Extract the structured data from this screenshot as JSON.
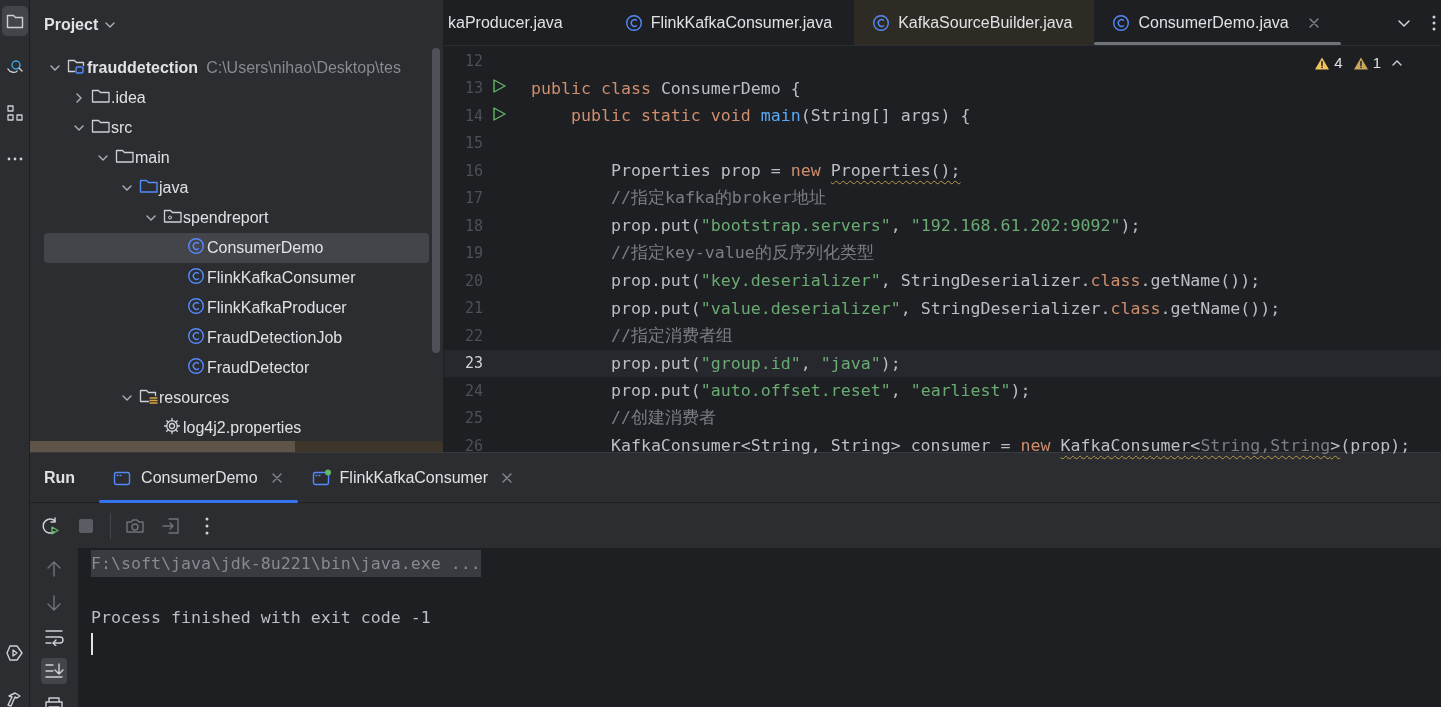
{
  "activity_bar": {
    "items": [
      {
        "kind": "project",
        "selected": true
      },
      {
        "kind": "find",
        "selected": false
      },
      {
        "kind": "structure",
        "selected": false
      },
      {
        "kind": "more",
        "selected": false
      }
    ],
    "bottom_items": [
      {
        "kind": "services"
      },
      {
        "kind": "build"
      }
    ]
  },
  "project_panel": {
    "title": "Project",
    "tree": [
      {
        "label": "frauddetection",
        "path": "C:\\Users\\nihao\\Desktop\\tes",
        "kind": "module",
        "expanded": true,
        "selected": false,
        "children": [
          {
            "label": ".idea",
            "kind": "folder",
            "expanded": false,
            "selected": false
          },
          {
            "label": "src",
            "kind": "folder",
            "expanded": true,
            "selected": false,
            "children": [
              {
                "label": "main",
                "kind": "folder",
                "expanded": true,
                "selected": false,
                "children": [
                  {
                    "label": "java",
                    "kind": "source",
                    "expanded": true,
                    "selected": false,
                    "children": [
                      {
                        "label": "spendreport",
                        "kind": "package",
                        "expanded": true,
                        "selected": false,
                        "children": [
                          {
                            "label": "ConsumerDemo",
                            "kind": "class",
                            "selected": true
                          },
                          {
                            "label": "FlinkKafkaConsumer",
                            "kind": "class",
                            "selected": false
                          },
                          {
                            "label": "FlinkKafkaProducer",
                            "kind": "class",
                            "selected": false
                          },
                          {
                            "label": "FraudDetectionJob",
                            "kind": "class",
                            "selected": false
                          },
                          {
                            "label": "FraudDetector",
                            "kind": "class",
                            "selected": false
                          }
                        ]
                      }
                    ]
                  },
                  {
                    "label": "resources",
                    "kind": "resources",
                    "expanded": true,
                    "selected": false,
                    "children": [
                      {
                        "label": "log4j2.properties",
                        "kind": "settings",
                        "selected": false
                      }
                    ]
                  }
                ]
              }
            ]
          }
        ]
      }
    ]
  },
  "editor": {
    "tabs": [
      {
        "label": "kaProducer.java",
        "kind": "clipped",
        "selected": false
      },
      {
        "label": "FlinkKafkaConsumer.java",
        "kind": "class",
        "selected": false
      },
      {
        "label": "KafkaSourceBuilder.java",
        "kind": "class",
        "selected": false
      },
      {
        "label": "ConsumerDemo.java",
        "kind": "class",
        "selected": true
      }
    ],
    "inspections": [
      {
        "kind": "warning",
        "count": "4"
      },
      {
        "kind": "weak_warning",
        "count": "1"
      }
    ],
    "lines": [
      {
        "number": "12",
        "runnable": false,
        "current": false
      },
      {
        "number": "13",
        "runnable": true,
        "current": false,
        "tokens": [
          {
            "kind": "keyword",
            "text": "public class "
          },
          {
            "kind": "plain",
            "text": "ConsumerDemo {"
          }
        ]
      },
      {
        "number": "14",
        "runnable": true,
        "current": false,
        "tokens": [
          {
            "kind": "keyword",
            "text": "    public static void "
          },
          {
            "kind": "method",
            "text": "main"
          },
          {
            "kind": "plain",
            "text": "(String[] args) {"
          }
        ]
      },
      {
        "number": "15",
        "runnable": false,
        "current": false
      },
      {
        "number": "16",
        "runnable": false,
        "current": false,
        "tokens": [
          {
            "kind": "plain",
            "text": "        Properties prop = "
          },
          {
            "kind": "keyword",
            "text": "new "
          },
          {
            "kind": "flagged",
            "text": "Properties();"
          }
        ]
      },
      {
        "number": "17",
        "runnable": false,
        "current": false,
        "tokens": [
          {
            "kind": "comment",
            "text": "        //指定kafka的broker地址"
          }
        ]
      },
      {
        "number": "18",
        "runnable": false,
        "current": false,
        "tokens": [
          {
            "kind": "plain",
            "text": "        prop.put("
          },
          {
            "kind": "string",
            "text": "\"bootstrap.servers\""
          },
          {
            "kind": "plain",
            "text": ", "
          },
          {
            "kind": "string",
            "text": "\"192.168.61.202:9092\""
          },
          {
            "kind": "plain",
            "text": ");"
          }
        ]
      },
      {
        "number": "19",
        "runnable": false,
        "current": false,
        "tokens": [
          {
            "kind": "comment",
            "text": "        //指定key-value的反序列化类型"
          }
        ]
      },
      {
        "number": "20",
        "runnable": false,
        "current": false,
        "tokens": [
          {
            "kind": "plain",
            "text": "        prop.put("
          },
          {
            "kind": "string",
            "text": "\"key.deserializer\""
          },
          {
            "kind": "plain",
            "text": ", StringDeserializer."
          },
          {
            "kind": "keyword",
            "text": "class"
          },
          {
            "kind": "plain",
            "text": ".getName());"
          }
        ]
      },
      {
        "number": "21",
        "runnable": false,
        "current": false,
        "tokens": [
          {
            "kind": "plain",
            "text": "        prop.put("
          },
          {
            "kind": "string",
            "text": "\"value.deserializer\""
          },
          {
            "kind": "plain",
            "text": ", StringDeserializer."
          },
          {
            "kind": "keyword",
            "text": "class"
          },
          {
            "kind": "plain",
            "text": ".getName());"
          }
        ]
      },
      {
        "number": "22",
        "runnable": false,
        "current": false,
        "tokens": [
          {
            "kind": "comment",
            "text": "        //指定消费者组"
          }
        ]
      },
      {
        "number": "23",
        "runnable": false,
        "current": true,
        "tokens": [
          {
            "kind": "plain",
            "text": "        prop.put("
          },
          {
            "kind": "string",
            "text": "\"group.id\""
          },
          {
            "kind": "plain",
            "text": ", "
          },
          {
            "kind": "string",
            "text": "\"java\""
          },
          {
            "kind": "plain",
            "text": ");"
          }
        ]
      },
      {
        "number": "24",
        "runnable": false,
        "current": false,
        "tokens": [
          {
            "kind": "plain",
            "text": "        prop.put("
          },
          {
            "kind": "string",
            "text": "\"auto.offset.reset\""
          },
          {
            "kind": "plain",
            "text": ", "
          },
          {
            "kind": "string",
            "text": "\"earliest\""
          },
          {
            "kind": "plain",
            "text": ");"
          }
        ]
      },
      {
        "number": "25",
        "runnable": false,
        "current": false,
        "tokens": [
          {
            "kind": "comment",
            "text": "        //创建消费者"
          }
        ]
      },
      {
        "number": "26",
        "runnable": false,
        "current": false,
        "tokens": [
          {
            "kind": "plain",
            "text": "        KafkaConsumer<String, String> consumer = "
          },
          {
            "kind": "keyword",
            "text": "new "
          },
          {
            "kind": "flagged",
            "text": "KafkaConsumer<"
          },
          {
            "kind": "flagged_dim",
            "text": "String,String"
          },
          {
            "kind": "flagged",
            "text": ">"
          },
          {
            "kind": "plain",
            "text": "(prop);"
          }
        ]
      }
    ]
  },
  "run_panel": {
    "title": "Run",
    "tabs": [
      {
        "label": "ConsumerDemo",
        "selected": true,
        "running": false
      },
      {
        "label": "FlinkKafkaConsumer",
        "selected": false,
        "running": true
      }
    ],
    "toolbar": [
      {
        "kind": "rerun",
        "disabled": false
      },
      {
        "kind": "stop",
        "disabled": true
      },
      {
        "kind": "screenshot",
        "disabled": true
      },
      {
        "kind": "exit",
        "disabled": true
      },
      {
        "kind": "more",
        "disabled": false
      }
    ],
    "side_tools": [
      {
        "kind": "up",
        "disabled": true,
        "selected": false
      },
      {
        "kind": "down",
        "disabled": true,
        "selected": false
      },
      {
        "kind": "wrap",
        "disabled": false,
        "selected": false
      },
      {
        "kind": "scroll_end",
        "disabled": false,
        "selected": true
      },
      {
        "kind": "print",
        "disabled": false,
        "selected": false
      }
    ],
    "console": {
      "lines": [
        {
          "kind": "command",
          "text": "F:\\soft\\java\\jdk-8u221\\bin\\java.exe ..."
        },
        {
          "kind": "output",
          "text": "Process finished with exit code -1"
        }
      ],
      "caret": true
    }
  }
}
